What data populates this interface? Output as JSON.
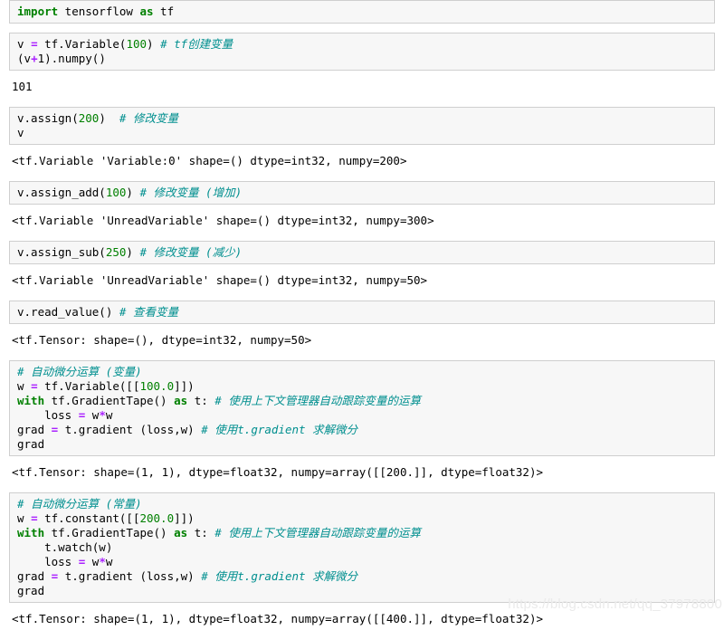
{
  "watermark": "https://blog.csdn.net/qq_37978800",
  "colors": {
    "keyword": "#008000",
    "number": "#008000",
    "operator": "#aa22ff",
    "comment": "#008f8f",
    "cell_bg": "#f7f7f7",
    "cell_border": "#cfcfcf",
    "page_bg": "#ffffff",
    "text": "#000000"
  },
  "cells": [
    {
      "type": "input",
      "lines": [
        [
          {
            "t": "import",
            "c": "kw"
          },
          {
            "t": " tensorflow ",
            "c": "plain"
          },
          {
            "t": "as",
            "c": "kw"
          },
          {
            "t": " tf",
            "c": "plain"
          }
        ]
      ]
    },
    {
      "type": "input",
      "lines": [
        [
          {
            "t": "v ",
            "c": "plain"
          },
          {
            "t": "=",
            "c": "op"
          },
          {
            "t": " tf.Variable(",
            "c": "plain"
          },
          {
            "t": "100",
            "c": "num"
          },
          {
            "t": ") ",
            "c": "plain"
          },
          {
            "t": "# tf创建变量",
            "c": "cmt"
          }
        ],
        [
          {
            "t": "(v",
            "c": "plain"
          },
          {
            "t": "+",
            "c": "op"
          },
          {
            "t": "1).numpy()",
            "c": "plain"
          }
        ]
      ]
    },
    {
      "type": "output",
      "lines": [
        [
          {
            "t": "101",
            "c": "plain"
          }
        ]
      ]
    },
    {
      "type": "input",
      "lines": [
        [
          {
            "t": "v.assign(",
            "c": "plain"
          },
          {
            "t": "200",
            "c": "num"
          },
          {
            "t": ")  ",
            "c": "plain"
          },
          {
            "t": "# 修改变量",
            "c": "cmt"
          }
        ],
        [
          {
            "t": "v",
            "c": "plain"
          }
        ]
      ]
    },
    {
      "type": "output",
      "lines": [
        [
          {
            "t": "<tf.Variable 'Variable:0' shape=() dtype=int32, numpy=200>",
            "c": "plain"
          }
        ]
      ]
    },
    {
      "type": "input",
      "lines": [
        [
          {
            "t": "v.assign_add(",
            "c": "plain"
          },
          {
            "t": "100",
            "c": "num"
          },
          {
            "t": ") ",
            "c": "plain"
          },
          {
            "t": "# 修改变量 (增加)",
            "c": "cmt"
          }
        ]
      ]
    },
    {
      "type": "output",
      "lines": [
        [
          {
            "t": "<tf.Variable 'UnreadVariable' shape=() dtype=int32, numpy=300>",
            "c": "plain"
          }
        ]
      ]
    },
    {
      "type": "input",
      "lines": [
        [
          {
            "t": "v.assign_sub(",
            "c": "plain"
          },
          {
            "t": "250",
            "c": "num"
          },
          {
            "t": ") ",
            "c": "plain"
          },
          {
            "t": "# 修改变量 (减少)",
            "c": "cmt"
          }
        ]
      ]
    },
    {
      "type": "output",
      "lines": [
        [
          {
            "t": "<tf.Variable 'UnreadVariable' shape=() dtype=int32, numpy=50>",
            "c": "plain"
          }
        ]
      ]
    },
    {
      "type": "input",
      "lines": [
        [
          {
            "t": "v.read_value() ",
            "c": "plain"
          },
          {
            "t": "# 查看变量",
            "c": "cmt"
          }
        ]
      ]
    },
    {
      "type": "output",
      "lines": [
        [
          {
            "t": "<tf.Tensor: shape=(), dtype=int32, numpy=50>",
            "c": "plain"
          }
        ]
      ]
    },
    {
      "type": "input",
      "lines": [
        [
          {
            "t": "# 自动微分运算 (变量)",
            "c": "cmt"
          }
        ],
        [
          {
            "t": "w ",
            "c": "plain"
          },
          {
            "t": "=",
            "c": "op"
          },
          {
            "t": " tf.Variable([[",
            "c": "plain"
          },
          {
            "t": "100.0",
            "c": "num"
          },
          {
            "t": "]])",
            "c": "plain"
          }
        ],
        [
          {
            "t": "with",
            "c": "kw"
          },
          {
            "t": " tf.GradientTape() ",
            "c": "plain"
          },
          {
            "t": "as",
            "c": "kw"
          },
          {
            "t": " t: ",
            "c": "plain"
          },
          {
            "t": "# 使用上下文管理器自动跟踪变量的运算",
            "c": "cmt"
          }
        ],
        [
          {
            "t": "    loss ",
            "c": "plain"
          },
          {
            "t": "=",
            "c": "op"
          },
          {
            "t": " w",
            "c": "plain"
          },
          {
            "t": "*",
            "c": "op"
          },
          {
            "t": "w",
            "c": "plain"
          }
        ],
        [
          {
            "t": "grad ",
            "c": "plain"
          },
          {
            "t": "=",
            "c": "op"
          },
          {
            "t": " t.gradient (loss,w) ",
            "c": "plain"
          },
          {
            "t": "# 使用t.gradient 求解微分",
            "c": "cmt"
          }
        ],
        [
          {
            "t": "grad",
            "c": "plain"
          }
        ]
      ]
    },
    {
      "type": "output",
      "lines": [
        [
          {
            "t": "<tf.Tensor: shape=(1, 1), dtype=float32, numpy=array([[200.]], dtype=float32)>",
            "c": "plain"
          }
        ]
      ]
    },
    {
      "type": "input",
      "lines": [
        [
          {
            "t": "# 自动微分运算 (常量)",
            "c": "cmt"
          }
        ],
        [
          {
            "t": "w ",
            "c": "plain"
          },
          {
            "t": "=",
            "c": "op"
          },
          {
            "t": " tf.constant([[",
            "c": "plain"
          },
          {
            "t": "200.0",
            "c": "num"
          },
          {
            "t": "]])",
            "c": "plain"
          }
        ],
        [
          {
            "t": "with",
            "c": "kw"
          },
          {
            "t": " tf.GradientTape() ",
            "c": "plain"
          },
          {
            "t": "as",
            "c": "kw"
          },
          {
            "t": " t: ",
            "c": "plain"
          },
          {
            "t": "# 使用上下文管理器自动跟踪变量的运算",
            "c": "cmt"
          }
        ],
        [
          {
            "t": "    t.watch(w)",
            "c": "plain"
          }
        ],
        [
          {
            "t": "    loss ",
            "c": "plain"
          },
          {
            "t": "=",
            "c": "op"
          },
          {
            "t": " w",
            "c": "plain"
          },
          {
            "t": "*",
            "c": "op"
          },
          {
            "t": "w",
            "c": "plain"
          }
        ],
        [
          {
            "t": "grad ",
            "c": "plain"
          },
          {
            "t": "=",
            "c": "op"
          },
          {
            "t": " t.gradient (loss,w) ",
            "c": "plain"
          },
          {
            "t": "# 使用t.gradient 求解微分",
            "c": "cmt"
          }
        ],
        [
          {
            "t": "grad",
            "c": "plain"
          }
        ]
      ]
    },
    {
      "type": "output",
      "lines": [
        [
          {
            "t": "<tf.Tensor: shape=(1, 1), dtype=float32, numpy=array([[400.]], dtype=float32)>",
            "c": "plain"
          }
        ]
      ]
    }
  ]
}
